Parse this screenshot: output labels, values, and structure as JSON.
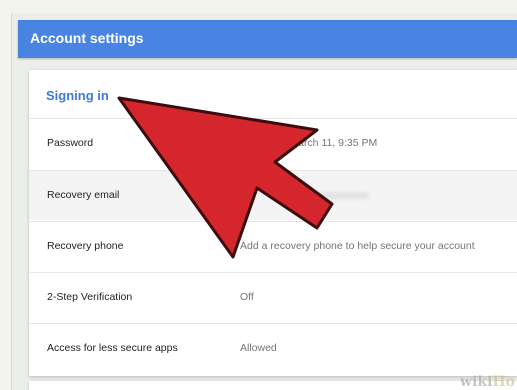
{
  "header": {
    "title": "Account settings"
  },
  "signin": {
    "title": "Signing in",
    "rows": [
      {
        "label": "Password",
        "value": "ged: March 11, 9:35 PM"
      },
      {
        "label": "Recovery email",
        "value": ""
      },
      {
        "label": "Recovery phone",
        "value": "Add a recovery phone to help secure your account"
      },
      {
        "label": "2-Step Verification",
        "value": "Off"
      },
      {
        "label": "Access for less secure apps",
        "value": "Allowed"
      }
    ]
  },
  "annotation": {
    "arrow_color": "#d6262d",
    "arrow_icon": "red-arrow-icon"
  },
  "watermark": {
    "part1": "wiki",
    "part2": "Ho"
  }
}
